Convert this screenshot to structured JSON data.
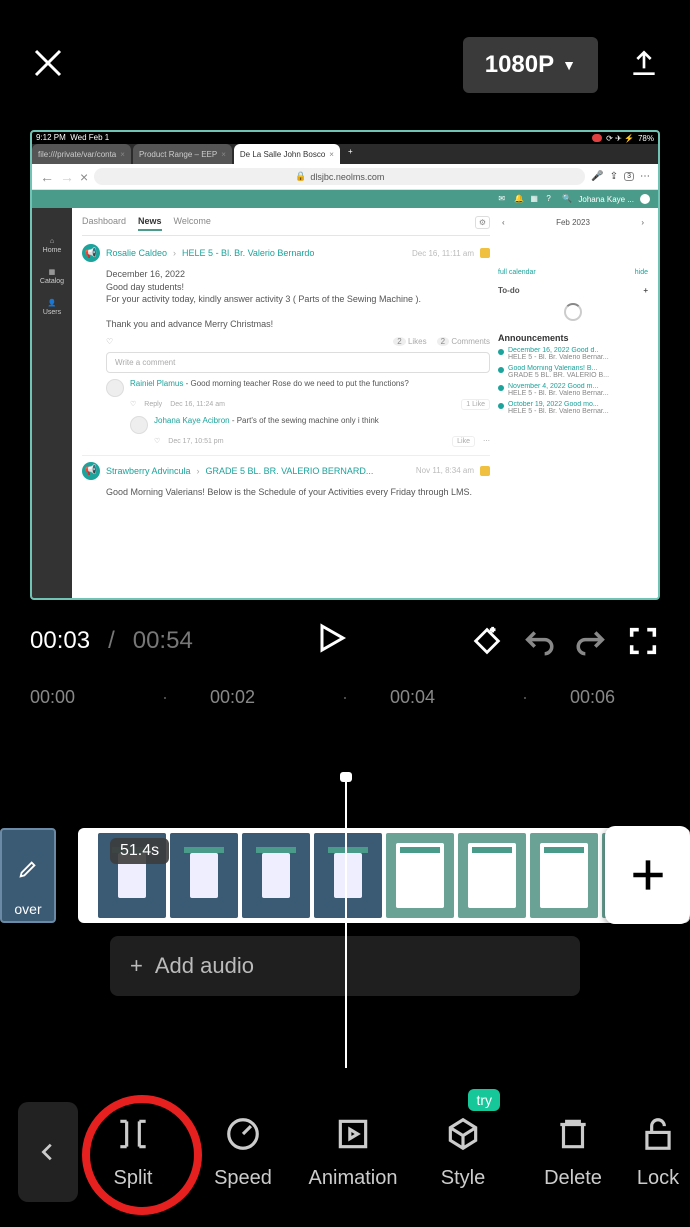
{
  "topbar": {
    "resolution_label": "1080P"
  },
  "preview": {
    "status_time": "9:12 PM",
    "status_date": "Wed Feb 1",
    "status_battery": "78%",
    "tabs": [
      {
        "label": "file:///private/var/conta"
      },
      {
        "label": "Product Range – EEP"
      },
      {
        "label": "De La Salle John Bosco"
      }
    ],
    "url": "dlsjbc.neolms.com",
    "user_label": "Johana Kaye ...",
    "sidebar": {
      "home": "Home",
      "catalog": "Catalog",
      "users": "Users"
    },
    "feed_tabs": {
      "dashboard": "Dashboard",
      "news": "News",
      "welcome": "Welcome"
    },
    "post1": {
      "author": "Rosalie Caldeo",
      "class": "HELE 5 - Bl. Br. Valerio Bernardo",
      "time": "Dec 16, 11:11 am",
      "line1": "December 16, 2022",
      "line2": "Good day students!",
      "line3": "For your activity today, kindly answer activity 3 ( Parts of the Sewing Machine ).",
      "line4": "Thank you and advance Merry Christmas!",
      "likes": "2",
      "likes_label": "Likes",
      "comments": "2",
      "comments_label": "Comments"
    },
    "comment_placeholder": "Write a comment",
    "reply1": {
      "author": "Rainiel Plamus",
      "text": " - Good morning teacher Rose do we need to put the functions?",
      "reply_label": "Reply",
      "time": "Dec 16, 11:24 am",
      "like_count": "1",
      "like_label": "Like"
    },
    "reply2": {
      "author": "Johana Kaye Acibron",
      "text": " - Part's of the sewing machine only i think",
      "time": "Dec 17, 10:51 pm",
      "like_label": "Like"
    },
    "post2": {
      "author": "Strawberry Advincula",
      "class": "GRADE 5 BL. BR. VALERIO BERNARD...",
      "time": "Nov 11, 8:34 am",
      "body": "Good Morning Valerians! Below is the Schedule of your Activities every Friday through LMS."
    },
    "calendar": {
      "month": "Feb 2023",
      "full": "full calendar",
      "hide": "hide"
    },
    "todo_label": "To-do",
    "announcements": {
      "header": "Announcements",
      "items": [
        {
          "title": "December 16, 2022 Good d..",
          "sub": "HELE 5 - Bl. Br. Valerio Bernar..."
        },
        {
          "title": "Good Morning Valerians! B...",
          "sub": "GRADE 5 BL. BR. VALERIO B..."
        },
        {
          "title": "November 4, 2022 Good m...",
          "sub": "HELE 5 - Bl. Br. Valerio Bernar..."
        },
        {
          "title": "October 19, 2022 Good mo...",
          "sub": "HELE 5 - Bl. Br. Valerio Bernar..."
        }
      ]
    }
  },
  "player": {
    "current": "00:03",
    "total": "00:54"
  },
  "ruler": [
    "00:00",
    "00:02",
    "00:04",
    "00:06"
  ],
  "clip": {
    "duration": "51.4s",
    "cover_label": "over"
  },
  "audio": {
    "label": "Add audio"
  },
  "tools": {
    "split": "Split",
    "speed": "Speed",
    "animation": "Animation",
    "style": "Style",
    "delete": "Delete",
    "lock": "Lock",
    "try": "try"
  }
}
